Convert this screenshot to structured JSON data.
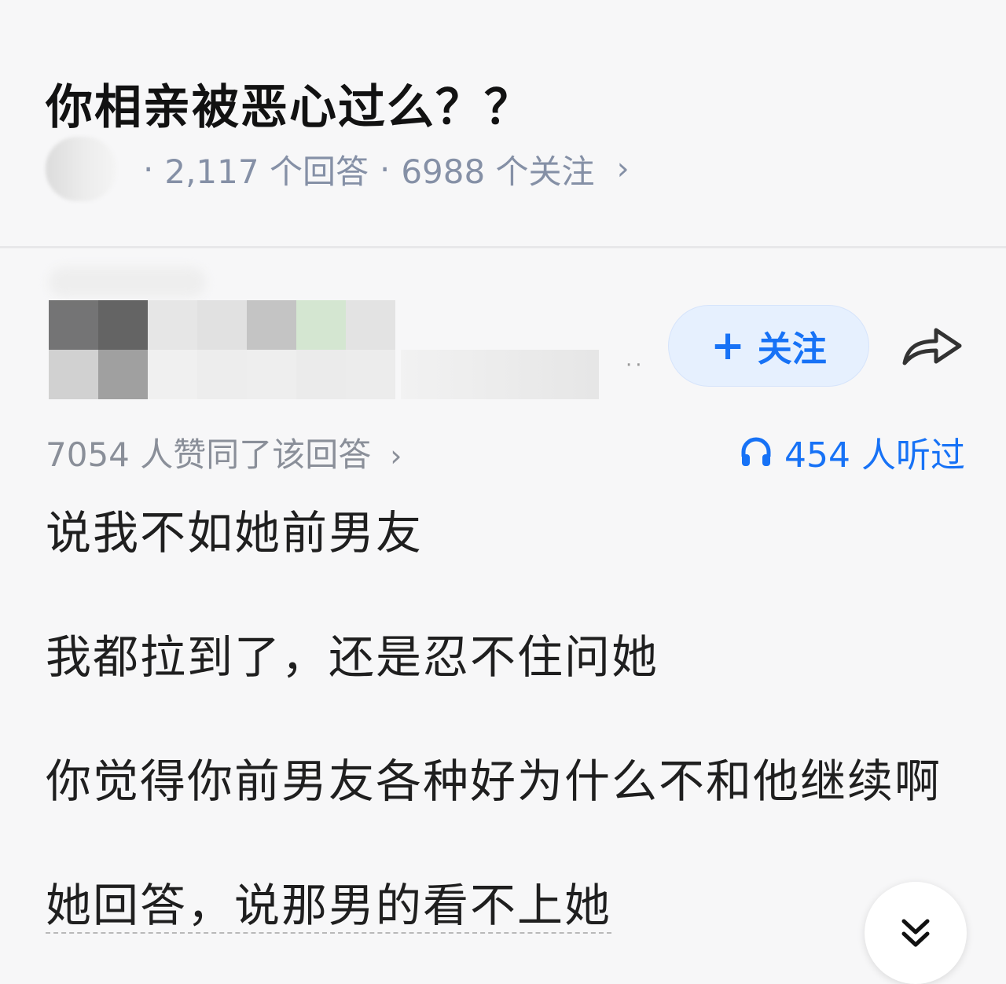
{
  "question": {
    "title": "你相亲被恶心过么？？",
    "answers_text": "2,117 个回答",
    "followers_text": "6988 个关注",
    "separator": "·"
  },
  "author": {
    "follow_label": "关注",
    "more_dots": "··"
  },
  "stats": {
    "approvals_text": "7054 人赞同了该回答",
    "listened_text": "454 人听过"
  },
  "answer": {
    "paragraphs": [
      "说我不如她前男友",
      "我都拉到了，还是忍不住问她",
      "你觉得你前男友各种好为什么不和他继续啊",
      "她回答，说那男的看不上她"
    ]
  },
  "icons": {
    "topic": "topic-avatar-blurred",
    "chevron": "chevron-right-icon",
    "share": "share-arrow-icon",
    "headphones": "headphones-icon",
    "expand": "double-chevron-down-icon"
  },
  "colors": {
    "accent": "#1772f6",
    "follow_bg": "#e6f0fe",
    "meta_gray": "#8590a6"
  }
}
